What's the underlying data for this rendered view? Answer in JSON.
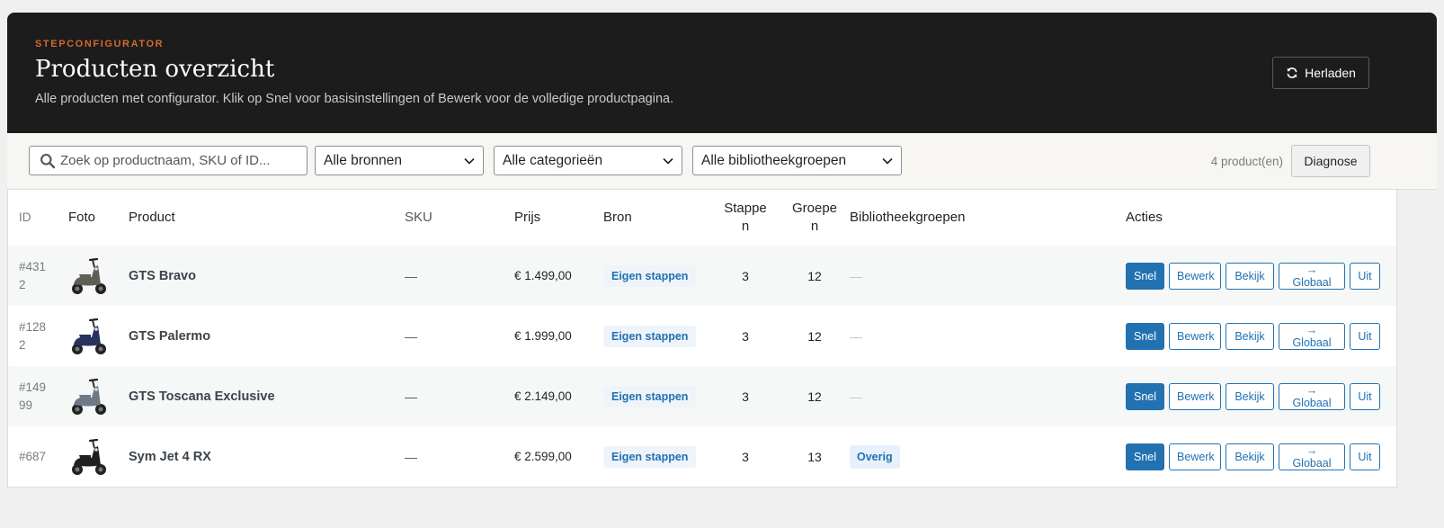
{
  "header": {
    "eyebrow": "STEPCONFIGURATOR",
    "title": "Producten overzicht",
    "subtitle": "Alle producten met configurator. Klik op Snel voor basisinstellingen of Bewerk voor de volledige productpagina.",
    "reload_label": "Herladen",
    "reload_icon": "refresh-icon"
  },
  "toolbar": {
    "search_placeholder": "Zoek op productnaam, SKU of ID...",
    "sources_selected": "Alle bronnen",
    "categories_selected": "Alle categorieën",
    "libgroups_selected": "Alle bibliotheekgroepen",
    "count_text": "4 product(en)",
    "diagnose_label": "Diagnose"
  },
  "table": {
    "headers": {
      "id": "ID",
      "foto": "Foto",
      "product": "Product",
      "sku": "SKU",
      "prijs": "Prijs",
      "bron": "Bron",
      "stappen": "Stappe\nn",
      "groepen": "Groepe\nn",
      "bib": "Bibliotheekgroepen",
      "acties": "Acties"
    },
    "action_labels": {
      "snel": "Snel",
      "bewerk": "Bewerk",
      "bekijk": "Bekijk",
      "globaal": "→ Globaal",
      "uit": "Uit"
    },
    "rows": [
      {
        "id": "#431\n2",
        "product": "GTS Bravo",
        "sku": "—",
        "prijs": "€ 1.499,00",
        "bron": "Eigen stappen",
        "stappen": "3",
        "groepen": "12",
        "bib": "—",
        "bib_is_badge": false,
        "scooter_color": "#5f5f58"
      },
      {
        "id": "#128\n2",
        "product": "GTS Palermo",
        "sku": "—",
        "prijs": "€ 1.999,00",
        "bron": "Eigen stappen",
        "stappen": "3",
        "groepen": "12",
        "bib": "—",
        "bib_is_badge": false,
        "scooter_color": "#27325e"
      },
      {
        "id": "#149\n99",
        "product": "GTS Toscana Exclusive",
        "sku": "—",
        "prijs": "€ 2.149,00",
        "bron": "Eigen stappen",
        "stappen": "3",
        "groepen": "12",
        "bib": "—",
        "bib_is_badge": false,
        "scooter_color": "#6e7986"
      },
      {
        "id": "#687",
        "product": "Sym Jet 4 RX",
        "sku": "—",
        "prijs": "€ 2.599,00",
        "bron": "Eigen stappen",
        "stappen": "3",
        "groepen": "13",
        "bib": "Overig",
        "bib_is_badge": true,
        "scooter_color": "#1f1f1f"
      }
    ]
  },
  "colors": {
    "header_bg": "#1c1c1c",
    "accent_orange": "#d3692f",
    "primary_blue": "#2271b1"
  }
}
